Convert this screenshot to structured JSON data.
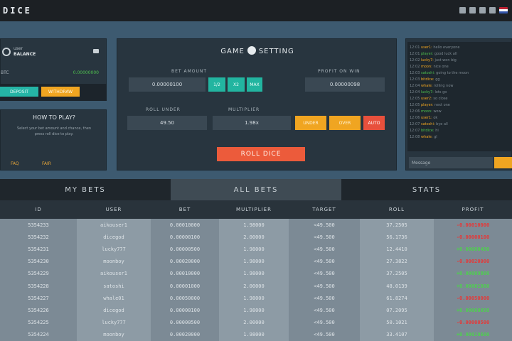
{
  "header": {
    "logo": "DICE"
  },
  "user_panel": {
    "username": "user",
    "balance_label": "BALANCE",
    "balance_row_label": "BTC",
    "balance_value": "0.00000000",
    "deposit_label": "DEPOSIT",
    "withdraw_label": "WITHDRAW"
  },
  "how_to": {
    "title": "HOW TO PLAY?",
    "text": "Select your bet amount and chance, then press roll dice to play.",
    "links": [
      "FAQ",
      "FAIR"
    ]
  },
  "game": {
    "title_left": "GAME",
    "title_right": "SETTING",
    "bet_amount_label": "BET AMOUNT",
    "bet_amount": "0.00000100",
    "half_label": "1/2",
    "double_label": "X2",
    "max_label": "MAX",
    "profit_label": "PROFIT ON WIN",
    "profit_value": "0.00000098",
    "roll_under_label": "ROLL UNDER",
    "roll_under_value": "49.50",
    "multiplier_label": "MULTIPLIER",
    "multiplier_value": "1.98x",
    "btn_under": "UNDER",
    "btn_over": "OVER",
    "btn_auto": "AUTO",
    "roll_button": "ROLL DICE"
  },
  "chat": {
    "lines": [
      {
        "t": "12:01",
        "u": "user1",
        "m": "hello everyone"
      },
      {
        "t": "12:01",
        "u": "player",
        "m": "good luck all"
      },
      {
        "t": "12:02",
        "u": "lucky7",
        "m": "just won big"
      },
      {
        "t": "12:02",
        "u": "moon",
        "m": "nice one"
      },
      {
        "t": "12:03",
        "u": "satoshi",
        "m": "going to the moon"
      },
      {
        "t": "12:03",
        "u": "bitdice",
        "m": "gg"
      },
      {
        "t": "12:04",
        "u": "whale",
        "m": "rolling now"
      },
      {
        "t": "12:04",
        "u": "lucky7",
        "m": "lets go"
      },
      {
        "t": "12:05",
        "u": "user2",
        "m": "so close"
      },
      {
        "t": "12:05",
        "u": "player",
        "m": "next one"
      },
      {
        "t": "12:06",
        "u": "moon",
        "m": "wow"
      },
      {
        "t": "12:06",
        "u": "user1",
        "m": "ok"
      },
      {
        "t": "12:07",
        "u": "satoshi",
        "m": "bye all"
      },
      {
        "t": "12:07",
        "u": "bitdice",
        "m": "hi"
      },
      {
        "t": "12:08",
        "u": "whale",
        "m": "gl"
      }
    ],
    "input_placeholder": "Message"
  },
  "tabs": [
    {
      "label": "MY BETS",
      "active": false
    },
    {
      "label": "ALL BETS",
      "active": true
    },
    {
      "label": "STATS",
      "active": false
    }
  ],
  "table": {
    "headers": [
      "ID",
      "USER",
      "BET",
      "MULTIPLIER",
      "TARGET",
      "ROLL",
      "PROFIT"
    ],
    "rows": [
      [
        "5354233",
        "aikouser1",
        "0.00010000",
        "1.98000",
        "<49.500",
        "37.2505",
        "-0.00010000",
        "neg"
      ],
      [
        "5354232",
        "dicegod",
        "0.00000100",
        "2.00000",
        "<49.500",
        "56.1736",
        "-0.00000100",
        "neg"
      ],
      [
        "5354231",
        "lucky777",
        "0.00000500",
        "1.98000",
        "<49.500",
        "12.4410",
        "+0.00000490",
        "pos"
      ],
      [
        "5354230",
        "moonboy",
        "0.00020000",
        "1.98000",
        "<49.500",
        "27.3822",
        "-0.00020000",
        "neg"
      ],
      [
        "5354229",
        "aikouser1",
        "0.00010000",
        "1.98000",
        "<49.500",
        "37.2505",
        "+0.00009800",
        "pos"
      ],
      [
        "5354228",
        "satoshi",
        "0.00001000",
        "2.00000",
        "<49.500",
        "48.0139",
        "+0.00001000",
        "pos"
      ],
      [
        "5354227",
        "whale01",
        "0.00050000",
        "1.98000",
        "<49.500",
        "61.8274",
        "-0.00050000",
        "neg"
      ],
      [
        "5354226",
        "dicegod",
        "0.00000100",
        "1.98000",
        "<49.500",
        "07.2095",
        "+0.00000098",
        "pos"
      ],
      [
        "5354225",
        "lucky777",
        "0.00000500",
        "2.00000",
        "<49.500",
        "50.1021",
        "-0.00000500",
        "neg"
      ],
      [
        "5354224",
        "moonboy",
        "0.00020000",
        "1.98000",
        "<49.500",
        "33.4107",
        "+0.00019600",
        "pos"
      ]
    ]
  }
}
